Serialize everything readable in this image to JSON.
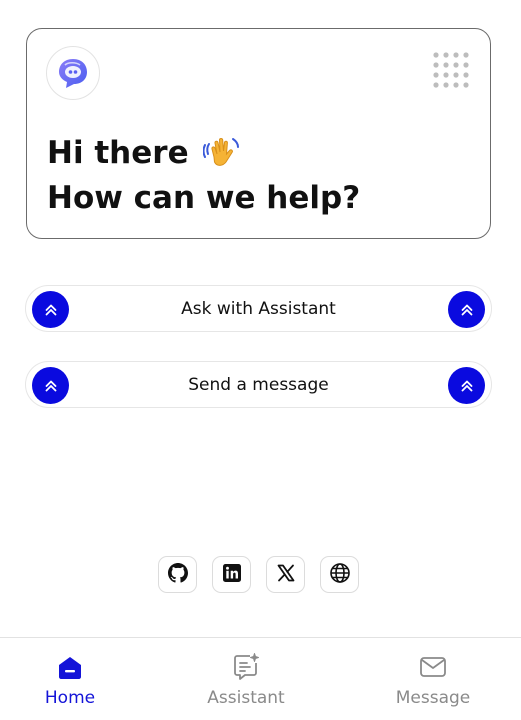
{
  "hero": {
    "greeting_line1": "Hi there",
    "greeting_line2": "How can we help?",
    "logo_icon": "chat-bubble-logo-icon",
    "wave_emoji": "👋"
  },
  "actions": [
    {
      "label": "Ask with Assistant",
      "icon": "chevron-up-double-icon"
    },
    {
      "label": "Send a message",
      "icon": "chevron-up-double-icon"
    }
  ],
  "socials": [
    {
      "icon": "github-icon"
    },
    {
      "icon": "linkedin-icon"
    },
    {
      "icon": "x-icon"
    },
    {
      "icon": "globe-icon"
    }
  ],
  "tabs": [
    {
      "label": "Home",
      "icon": "home-icon",
      "active": true
    },
    {
      "label": "Assistant",
      "icon": "assistant-icon",
      "active": false
    },
    {
      "label": "Message",
      "icon": "mail-icon",
      "active": false
    }
  ],
  "colors": {
    "accent": "#0a0adf",
    "tab_active": "#1414d8",
    "tab_inactive": "#8a8a8a",
    "logo_purple": "#6b5cf0"
  }
}
